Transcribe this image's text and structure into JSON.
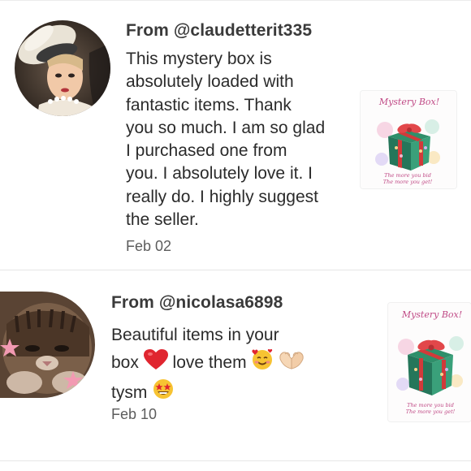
{
  "reviews": [
    {
      "from": "From @claudetterit335",
      "text": "This mystery box is absolutely loaded with fantastic items. Thank you so much. I am so glad I purchased one from you. I absolutely love it. I really do. I highly suggest the seller.",
      "lines": [
        "This mystery box is",
        "absolutely loaded with",
        "fantastic items. Thank",
        "you so much. I am so glad",
        "I purchased one from",
        "you. I absolutely love it. I",
        "really do. I highly suggest",
        "the seller."
      ],
      "date": "Feb 02",
      "thumbnail": {
        "title": "Mystery Box!",
        "caption_line1": "The more you bid",
        "caption_line2": "The more you get!"
      }
    },
    {
      "from": "From @nicolasa6898",
      "line1": "Beautiful items in your",
      "line2_a": "box",
      "line2_b": "love them",
      "line3": "tysm",
      "date": "Feb 10",
      "thumbnail": {
        "title": "Mystery Box!",
        "caption_line1": "The more you bid",
        "caption_line2": "The more you get!"
      }
    }
  ],
  "icons": [
    "heart-emoji",
    "smiling-face-with-hearts-emoji",
    "heart-hands-emoji",
    "star-struck-emoji"
  ],
  "colors": {
    "accent_pink": "#c04a86",
    "gift_green": "#2f8f6a",
    "ribbon_red": "#d13a3a",
    "divider": "#e6e6e6"
  }
}
